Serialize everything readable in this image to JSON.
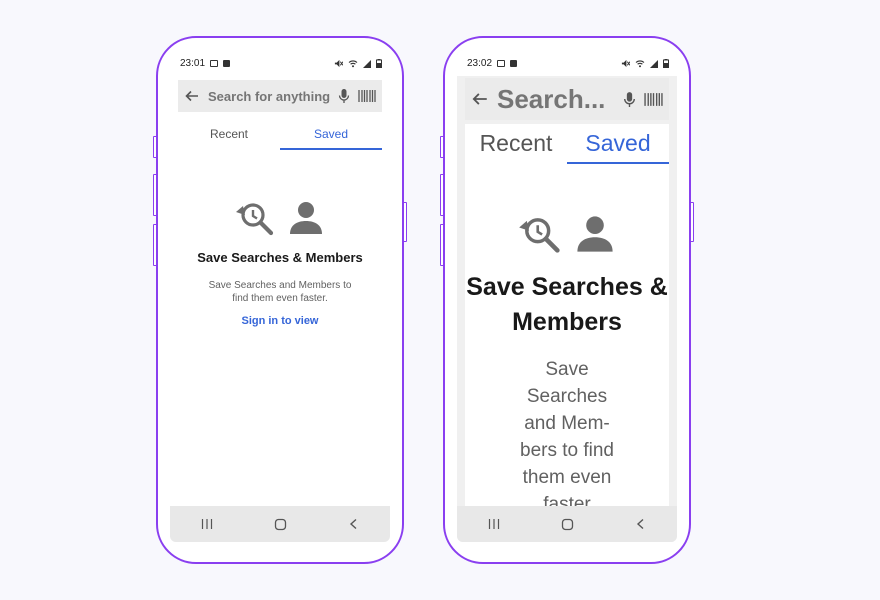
{
  "phones": [
    {
      "status": {
        "time": "23:01"
      },
      "search": {
        "placeholder": "Search for anything",
        "back_icon": "arrow-left-icon",
        "mic_icon": "microphone-icon",
        "barcode_icon": "barcode-icon"
      },
      "tabs": [
        "Recent",
        "Saved"
      ],
      "active_tab": "Saved",
      "empty_state": {
        "title": "Save Searches & Members",
        "description": "Save Searches and Members to find them even faster.",
        "link": "Sign in to view"
      },
      "nav_icons": [
        "recent-apps-icon",
        "home-icon",
        "back-icon"
      ]
    },
    {
      "status": {
        "time": "23:02"
      },
      "search": {
        "placeholder": "Search...",
        "back_icon": "arrow-left-icon",
        "mic_icon": "microphone-icon",
        "barcode_icon": "barcode-icon"
      },
      "tabs": [
        "Recent",
        "Saved"
      ],
      "active_tab": "Saved",
      "empty_state": {
        "title": "Save Searches & Members",
        "description": "Save Searches and Mem- bers to find them even faster"
      },
      "nav_icons": [
        "recent-apps-icon",
        "home-icon",
        "back-icon"
      ]
    }
  ],
  "colors": {
    "frame": "#8a3ff0",
    "accent": "#3565d8",
    "search_bg": "#ebebeb"
  }
}
